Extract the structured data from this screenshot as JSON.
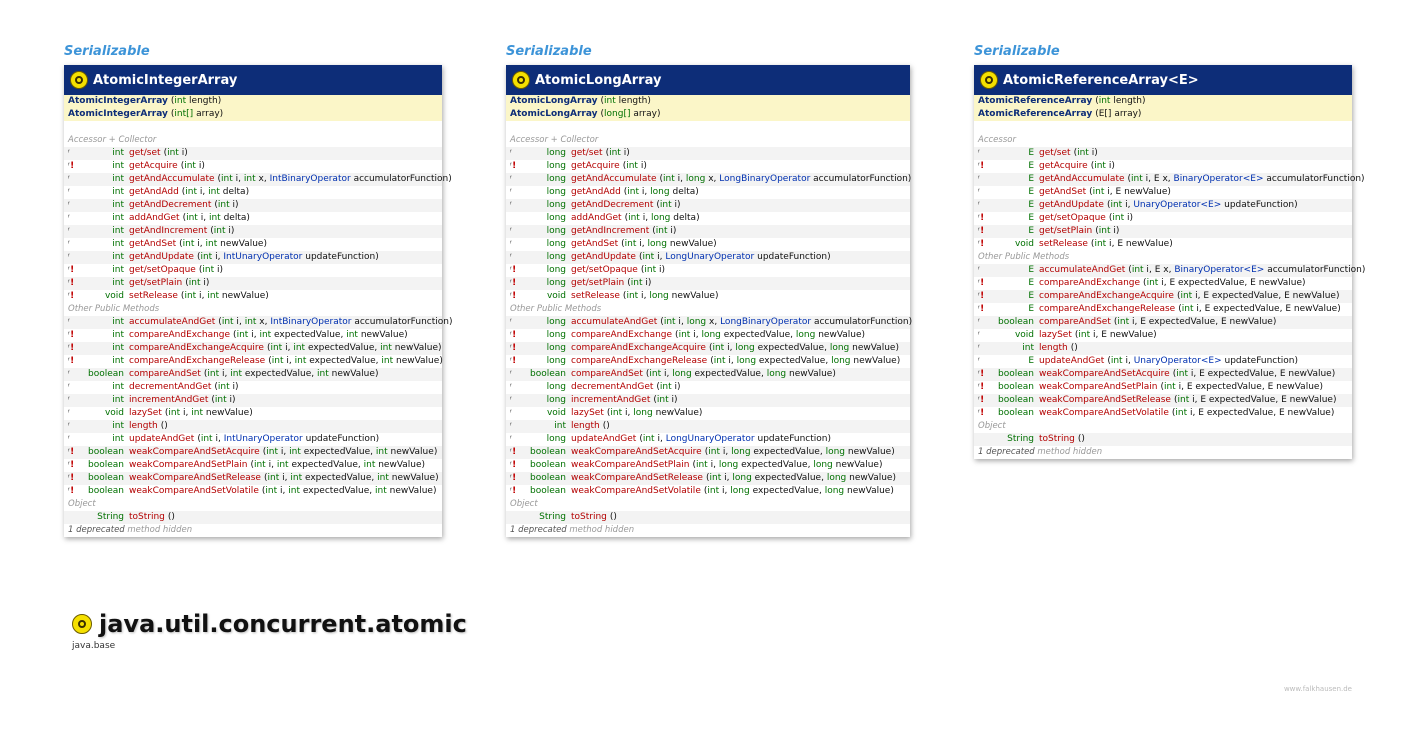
{
  "package": {
    "name": "java.util.concurrent.atomic",
    "module": "java.base"
  },
  "credit": "www.falkhausen.de",
  "classes": [
    {
      "interface": "Serializable",
      "name": "AtomicIntegerArray",
      "constructors": [
        {
          "name": "AtomicIntegerArray",
          "params": "(int length)"
        },
        {
          "name": "AtomicIntegerArray",
          "params": "(int[] array)"
        }
      ],
      "sections": [
        {
          "title": "Accessor + Collector",
          "rows": [
            {
              "mark": "ᶠ",
              "ex": "",
              "type": "int",
              "name": "get/set",
              "params": "(int i)"
            },
            {
              "mark": "ᶠ",
              "ex": "!",
              "type": "int",
              "name": "getAcquire",
              "params": "(int i)"
            },
            {
              "mark": "ᶠ",
              "ex": "",
              "type": "int",
              "name": "getAndAccumulate",
              "params": "(int i, int x, IntBinaryOperator accumulatorFunction)"
            },
            {
              "mark": "ᶠ",
              "ex": "",
              "type": "int",
              "name": "getAndAdd",
              "params": "(int i, int delta)"
            },
            {
              "mark": "ᶠ",
              "ex": "",
              "type": "int",
              "name": "getAndDecrement",
              "params": "(int i)"
            },
            {
              "mark": "ᶠ",
              "ex": "",
              "type": "int",
              "name": "addAndGet",
              "params": "(int i, int delta)"
            },
            {
              "mark": "ᶠ",
              "ex": "",
              "type": "int",
              "name": "getAndIncrement",
              "params": "(int i)"
            },
            {
              "mark": "ᶠ",
              "ex": "",
              "type": "int",
              "name": "getAndSet",
              "params": "(int i, int newValue)"
            },
            {
              "mark": "ᶠ",
              "ex": "",
              "type": "int",
              "name": "getAndUpdate",
              "params": "(int i, IntUnaryOperator updateFunction)"
            },
            {
              "mark": "ᶠ",
              "ex": "!",
              "type": "int",
              "name": "get/setOpaque",
              "params": "(int i)"
            },
            {
              "mark": "ᶠ",
              "ex": "!",
              "type": "int",
              "name": "get/setPlain",
              "params": "(int i)"
            },
            {
              "mark": "ᶠ",
              "ex": "!",
              "type": "void",
              "name": "setRelease",
              "params": "(int i, int newValue)"
            }
          ]
        },
        {
          "title": "Other Public Methods",
          "rows": [
            {
              "mark": "ᶠ",
              "ex": "",
              "type": "int",
              "name": "accumulateAndGet",
              "params": "(int i, int x, IntBinaryOperator accumulatorFunction)"
            },
            {
              "mark": "ᶠ",
              "ex": "!",
              "type": "int",
              "name": "compareAndExchange",
              "params": "(int i, int expectedValue, int newValue)"
            },
            {
              "mark": "ᶠ",
              "ex": "!",
              "type": "int",
              "name": "compareAndExchangeAcquire",
              "params": "(int i, int expectedValue, int newValue)"
            },
            {
              "mark": "ᶠ",
              "ex": "!",
              "type": "int",
              "name": "compareAndExchangeRelease",
              "params": "(int i, int expectedValue, int newValue)"
            },
            {
              "mark": "ᶠ",
              "ex": "",
              "type": "boolean",
              "name": "compareAndSet",
              "params": "(int i, int expectedValue, int newValue)"
            },
            {
              "mark": "ᶠ",
              "ex": "",
              "type": "int",
              "name": "decrementAndGet",
              "params": "(int i)"
            },
            {
              "mark": "ᶠ",
              "ex": "",
              "type": "int",
              "name": "incrementAndGet",
              "params": "(int i)"
            },
            {
              "mark": "ᶠ",
              "ex": "",
              "type": "void",
              "name": "lazySet",
              "params": "(int i, int newValue)"
            },
            {
              "mark": "ᶠ",
              "ex": "",
              "type": "int",
              "name": "length",
              "params": "()"
            },
            {
              "mark": "ᶠ",
              "ex": "",
              "type": "int",
              "name": "updateAndGet",
              "params": "(int i, IntUnaryOperator updateFunction)"
            },
            {
              "mark": "ᶠ",
              "ex": "!",
              "type": "boolean",
              "name": "weakCompareAndSetAcquire",
              "params": "(int i, int expectedValue, int newValue)"
            },
            {
              "mark": "ᶠ",
              "ex": "!",
              "type": "boolean",
              "name": "weakCompareAndSetPlain",
              "params": "(int i, int expectedValue, int newValue)"
            },
            {
              "mark": "ᶠ",
              "ex": "!",
              "type": "boolean",
              "name": "weakCompareAndSetRelease",
              "params": "(int i, int expectedValue, int newValue)"
            },
            {
              "mark": "ᶠ",
              "ex": "!",
              "type": "boolean",
              "name": "weakCompareAndSetVolatile",
              "params": "(int i, int expectedValue, int newValue)"
            }
          ]
        },
        {
          "title": "Object",
          "rows": [
            {
              "mark": "",
              "ex": "",
              "type": "String",
              "name": "toString",
              "params": "()"
            }
          ]
        }
      ],
      "footer_count": "1 deprecated",
      "footer_hidden": "method hidden"
    },
    {
      "interface": "Serializable",
      "name": "AtomicLongArray",
      "constructors": [
        {
          "name": "AtomicLongArray",
          "params": "(int length)"
        },
        {
          "name": "AtomicLongArray",
          "params": "(long[] array)"
        }
      ],
      "sections": [
        {
          "title": "Accessor + Collector",
          "rows": [
            {
              "mark": "ᶠ",
              "ex": "",
              "type": "long",
              "name": "get/set",
              "params": "(int i)"
            },
            {
              "mark": "ᶠ",
              "ex": "!",
              "type": "long",
              "name": "getAcquire",
              "params": "(int i)"
            },
            {
              "mark": "ᶠ",
              "ex": "",
              "type": "long",
              "name": "getAndAccumulate",
              "params": "(int i, long x, LongBinaryOperator accumulatorFunction)"
            },
            {
              "mark": "ᶠ",
              "ex": "",
              "type": "long",
              "name": "getAndAdd",
              "params": "(int i, long delta)"
            },
            {
              "mark": "ᶠ",
              "ex": "",
              "type": "long",
              "name": "getAndDecrement",
              "params": "(int i)"
            },
            {
              "mark": "",
              "ex": "",
              "type": "long",
              "name": "addAndGet",
              "params": "(int i, long delta)"
            },
            {
              "mark": "ᶠ",
              "ex": "",
              "type": "long",
              "name": "getAndIncrement",
              "params": "(int i)"
            },
            {
              "mark": "ᶠ",
              "ex": "",
              "type": "long",
              "name": "getAndSet",
              "params": "(int i, long newValue)"
            },
            {
              "mark": "ᶠ",
              "ex": "",
              "type": "long",
              "name": "getAndUpdate",
              "params": "(int i, LongUnaryOperator updateFunction)"
            },
            {
              "mark": "ᶠ",
              "ex": "!",
              "type": "long",
              "name": "get/setOpaque",
              "params": "(int i)"
            },
            {
              "mark": "ᶠ",
              "ex": "!",
              "type": "long",
              "name": "get/setPlain",
              "params": "(int i)"
            },
            {
              "mark": "ᶠ",
              "ex": "!",
              "type": "void",
              "name": "setRelease",
              "params": "(int i, long newValue)"
            }
          ]
        },
        {
          "title": "Other Public Methods",
          "rows": [
            {
              "mark": "ᶠ",
              "ex": "",
              "type": "long",
              "name": "accumulateAndGet",
              "params": "(int i, long x, LongBinaryOperator accumulatorFunction)"
            },
            {
              "mark": "ᶠ",
              "ex": "!",
              "type": "long",
              "name": "compareAndExchange",
              "params": "(int i, long expectedValue, long newValue)"
            },
            {
              "mark": "ᶠ",
              "ex": "!",
              "type": "long",
              "name": "compareAndExchangeAcquire",
              "params": "(int i, long expectedValue, long newValue)"
            },
            {
              "mark": "ᶠ",
              "ex": "!",
              "type": "long",
              "name": "compareAndExchangeRelease",
              "params": "(int i, long expectedValue, long newValue)"
            },
            {
              "mark": "ᶠ",
              "ex": "",
              "type": "boolean",
              "name": "compareAndSet",
              "params": "(int i, long expectedValue, long newValue)"
            },
            {
              "mark": "ᶠ",
              "ex": "",
              "type": "long",
              "name": "decrementAndGet",
              "params": "(int i)"
            },
            {
              "mark": "ᶠ",
              "ex": "",
              "type": "long",
              "name": "incrementAndGet",
              "params": "(int i)"
            },
            {
              "mark": "ᶠ",
              "ex": "",
              "type": "void",
              "name": "lazySet",
              "params": "(int i, long newValue)"
            },
            {
              "mark": "ᶠ",
              "ex": "",
              "type": "int",
              "name": "length",
              "params": "()"
            },
            {
              "mark": "ᶠ",
              "ex": "",
              "type": "long",
              "name": "updateAndGet",
              "params": "(int i, LongUnaryOperator updateFunction)"
            },
            {
              "mark": "ᶠ",
              "ex": "!",
              "type": "boolean",
              "name": "weakCompareAndSetAcquire",
              "params": "(int i, long expectedValue, long newValue)"
            },
            {
              "mark": "ᶠ",
              "ex": "!",
              "type": "boolean",
              "name": "weakCompareAndSetPlain",
              "params": "(int i, long expectedValue, long newValue)"
            },
            {
              "mark": "ᶠ",
              "ex": "!",
              "type": "boolean",
              "name": "weakCompareAndSetRelease",
              "params": "(int i, long expectedValue, long newValue)"
            },
            {
              "mark": "ᶠ",
              "ex": "!",
              "type": "boolean",
              "name": "weakCompareAndSetVolatile",
              "params": "(int i, long expectedValue, long newValue)"
            }
          ]
        },
        {
          "title": "Object",
          "rows": [
            {
              "mark": "",
              "ex": "",
              "type": "String",
              "name": "toString",
              "params": "()"
            }
          ]
        }
      ],
      "footer_count": "1 deprecated",
      "footer_hidden": "method hidden"
    },
    {
      "interface": "Serializable",
      "name": "AtomicReferenceArray<E>",
      "constructors": [
        {
          "name": "AtomicReferenceArray",
          "params": "(int length)"
        },
        {
          "name": "AtomicReferenceArray",
          "params": "(E[] array)"
        }
      ],
      "sections": [
        {
          "title": "Accessor",
          "rows": [
            {
              "mark": "ᶠ",
              "ex": "",
              "type": "E",
              "name": "get/set",
              "params": "(int i)"
            },
            {
              "mark": "ᶠ",
              "ex": "!",
              "type": "E",
              "name": "getAcquire",
              "params": "(int i)"
            },
            {
              "mark": "ᶠ",
              "ex": "",
              "type": "E",
              "name": "getAndAccumulate",
              "params": "(int i, E x, BinaryOperator<E> accumulatorFunction)"
            },
            {
              "mark": "ᶠ",
              "ex": "",
              "type": "E",
              "name": "getAndSet",
              "params": "(int i, E newValue)"
            },
            {
              "mark": "ᶠ",
              "ex": "",
              "type": "E",
              "name": "getAndUpdate",
              "params": "(int i, UnaryOperator<E> updateFunction)"
            },
            {
              "mark": "ᶠ",
              "ex": "!",
              "type": "E",
              "name": "get/setOpaque",
              "params": "(int i)"
            },
            {
              "mark": "ᶠ",
              "ex": "!",
              "type": "E",
              "name": "get/setPlain",
              "params": "(int i)"
            },
            {
              "mark": "ᶠ",
              "ex": "!",
              "type": "void",
              "name": "setRelease",
              "params": "(int i, E newValue)"
            }
          ]
        },
        {
          "title": "Other Public Methods",
          "rows": [
            {
              "mark": "ᶠ",
              "ex": "",
              "type": "E",
              "name": "accumulateAndGet",
              "params": "(int i, E x, BinaryOperator<E> accumulatorFunction)"
            },
            {
              "mark": "ᶠ",
              "ex": "!",
              "type": "E",
              "name": "compareAndExchange",
              "params": "(int i, E expectedValue, E newValue)"
            },
            {
              "mark": "ᶠ",
              "ex": "!",
              "type": "E",
              "name": "compareAndExchangeAcquire",
              "params": "(int i, E expectedValue, E newValue)"
            },
            {
              "mark": "ᶠ",
              "ex": "!",
              "type": "E",
              "name": "compareAndExchangeRelease",
              "params": "(int i, E expectedValue, E newValue)"
            },
            {
              "mark": "ᶠ",
              "ex": "",
              "type": "boolean",
              "name": "compareAndSet",
              "params": "(int i, E expectedValue, E newValue)"
            },
            {
              "mark": "ᶠ",
              "ex": "",
              "type": "void",
              "name": "lazySet",
              "params": "(int i, E newValue)"
            },
            {
              "mark": "ᶠ",
              "ex": "",
              "type": "int",
              "name": "length",
              "params": "()"
            },
            {
              "mark": "ᶠ",
              "ex": "",
              "type": "E",
              "name": "updateAndGet",
              "params": "(int i, UnaryOperator<E> updateFunction)"
            },
            {
              "mark": "ᶠ",
              "ex": "!",
              "type": "boolean",
              "name": "weakCompareAndSetAcquire",
              "params": "(int i, E expectedValue, E newValue)"
            },
            {
              "mark": "ᶠ",
              "ex": "!",
              "type": "boolean",
              "name": "weakCompareAndSetPlain",
              "params": "(int i, E expectedValue, E newValue)"
            },
            {
              "mark": "ᶠ",
              "ex": "!",
              "type": "boolean",
              "name": "weakCompareAndSetRelease",
              "params": "(int i, E expectedValue, E newValue)"
            },
            {
              "mark": "ᶠ",
              "ex": "!",
              "type": "boolean",
              "name": "weakCompareAndSetVolatile",
              "params": "(int i, E expectedValue, E newValue)"
            }
          ]
        },
        {
          "title": "Object",
          "rows": [
            {
              "mark": "",
              "ex": "",
              "type": "String",
              "name": "toString",
              "params": "()"
            }
          ]
        }
      ],
      "footer_count": "1 deprecated",
      "footer_hidden": "method hidden"
    }
  ]
}
